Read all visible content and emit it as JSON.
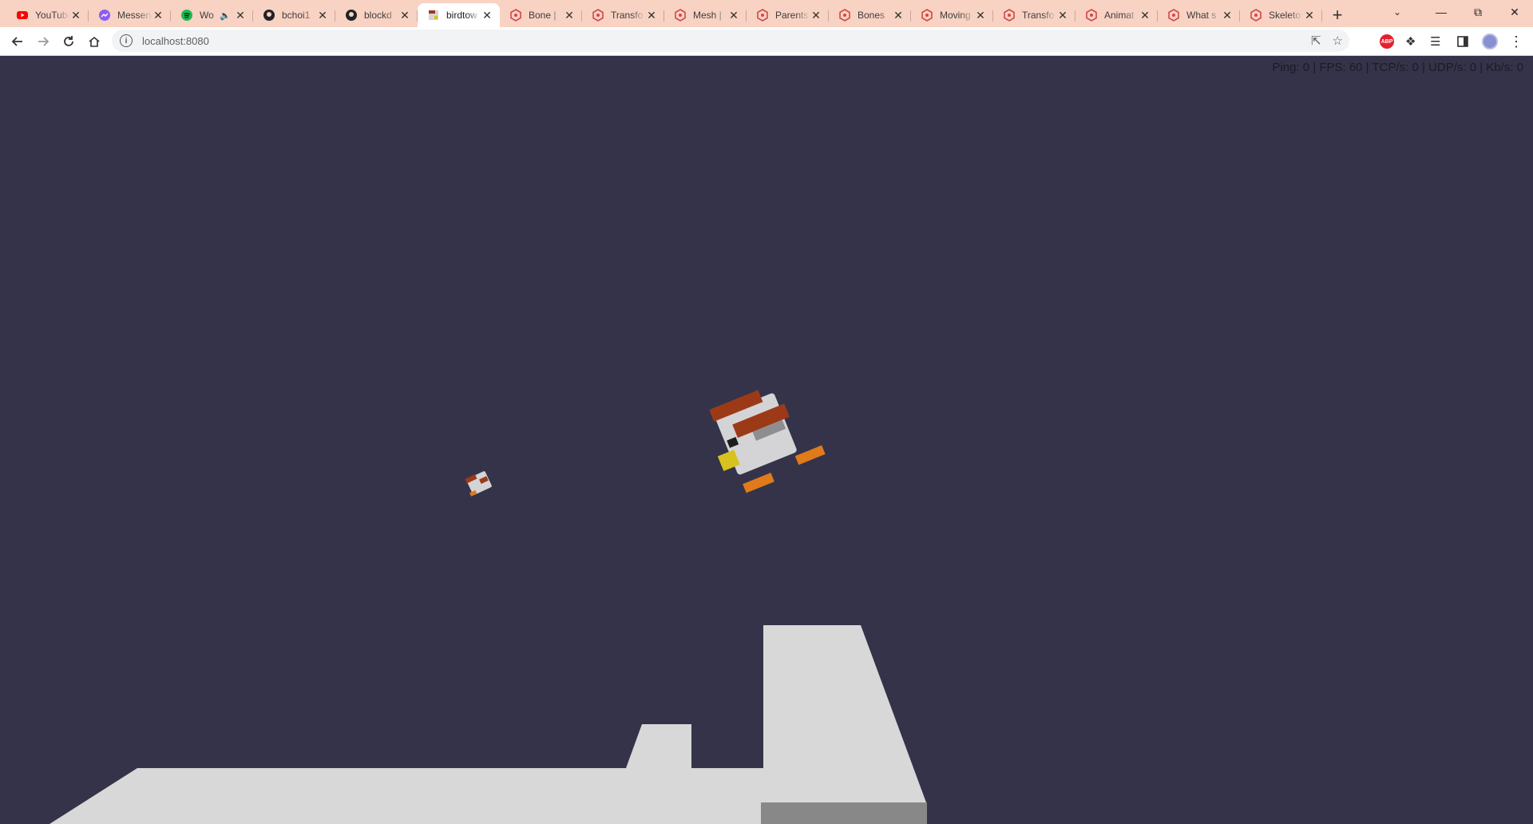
{
  "browser": {
    "tabs": [
      {
        "title": "YouTube",
        "icon": "youtube-icon",
        "active": false
      },
      {
        "title": "Messenger",
        "icon": "messenger-icon",
        "active": false
      },
      {
        "title": "Wo",
        "icon": "spotify-icon",
        "active": false,
        "audio": true
      },
      {
        "title": "bchoi1",
        "icon": "github-icon",
        "active": false
      },
      {
        "title": "blockd",
        "icon": "github-icon",
        "active": false
      },
      {
        "title": "birdtow",
        "icon": "birdtown-icon",
        "active": true
      },
      {
        "title": "Bone |",
        "icon": "babylon-icon",
        "active": false
      },
      {
        "title": "Transfo",
        "icon": "babylon-icon",
        "active": false
      },
      {
        "title": "Mesh |",
        "icon": "babylon-icon",
        "active": false
      },
      {
        "title": "Parents",
        "icon": "babylon-icon",
        "active": false
      },
      {
        "title": "Bones",
        "icon": "babylon-icon",
        "active": false
      },
      {
        "title": "Moving",
        "icon": "babylon-icon",
        "active": false
      },
      {
        "title": "Transfo",
        "icon": "babylon-icon",
        "active": false
      },
      {
        "title": "Animat",
        "icon": "babylon-icon",
        "active": false
      },
      {
        "title": "What s",
        "icon": "babylon-icon",
        "active": false
      },
      {
        "title": "Skeleto",
        "icon": "babylon-icon",
        "active": false
      }
    ],
    "new_tab": "+",
    "url": "localhost:8080",
    "tab_color": "#f8d2c2"
  },
  "game": {
    "stats": "Ping: 0 | FPS: 60 | TCP/s: 0 | UDP/s: 0 | Kb/s: 0",
    "background": "#34334a",
    "platform_color": "#d8d8d8"
  }
}
